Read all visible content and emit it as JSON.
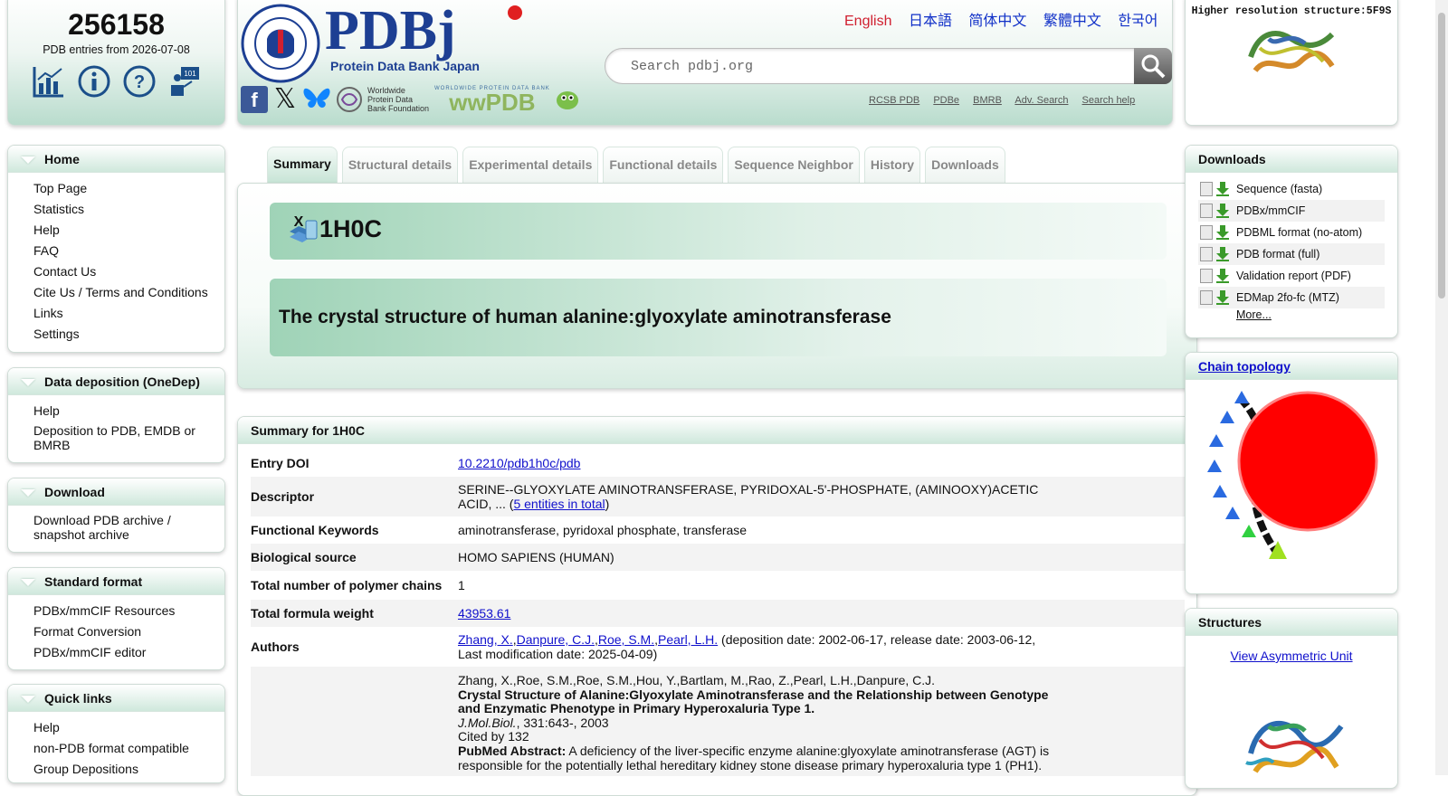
{
  "counter": {
    "number": "256158",
    "subtitle": "PDB entries from 2026-07-08"
  },
  "header": {
    "logo_text": "PDBj",
    "logo_sub": "Protein Data Bank Japan",
    "seal_text": "PROTEIN DATA BANK JAPAN · THE UNIVERSITY OF OSAKA",
    "wwpdb_foundation": "Worldwide Protein Data Bank Foundation",
    "wwpdb_text": "WORLDWIDE PROTEIN DATA BANK",
    "languages": [
      "English",
      "日本語",
      "简体中文",
      "繁體中文",
      "한국어"
    ],
    "search_placeholder": "Search pdbj.org",
    "ext_links": [
      "RCSB PDB",
      "PDBe",
      "BMRB",
      "Adv. Search",
      "Search help"
    ]
  },
  "hires": {
    "title": "Higher resolution structure:5F9S"
  },
  "nav": [
    {
      "title": "Home",
      "items": [
        "Top Page",
        "Statistics",
        "Help",
        "FAQ",
        "Contact Us",
        "Cite Us / Terms and Conditions",
        "Links",
        "Settings"
      ]
    },
    {
      "title": "Data deposition (OneDep)",
      "items": [
        "Help",
        "Deposition to PDB, EMDB or BMRB"
      ]
    },
    {
      "title": "Download",
      "items": [
        "Download PDB archive / snapshot archive"
      ]
    },
    {
      "title": "Standard format",
      "items": [
        "PDBx/mmCIF Resources",
        "Format Conversion",
        "PDBx/mmCIF editor"
      ]
    },
    {
      "title": "Quick links",
      "items": [
        "Help",
        "non-PDB format compatible",
        "Group Depositions"
      ]
    }
  ],
  "tabs": [
    "Summary",
    "Structural details",
    "Experimental details",
    "Functional details",
    "Sequence Neighbor",
    "History",
    "Downloads"
  ],
  "entry": {
    "id": "1H0C",
    "title": "The crystal structure of human alanine:glyoxylate aminotransferase"
  },
  "summary": {
    "header": "Summary for 1H0C",
    "doi_label": "Entry DOI",
    "doi": "10.2210/pdb1h0c/pdb",
    "descriptor_label": "Descriptor",
    "descriptor": "SERINE--GLYOXYLATE AMINOTRANSFERASE, PYRIDOXAL-5'-PHOSPHATE, (AMINOOXY)ACETIC ACID, ... (",
    "descriptor_link": "5 entities in total",
    "descriptor_end": ")",
    "keywords_label": "Functional Keywords",
    "keywords": "aminotransferase, pyridoxal phosphate, transferase",
    "source_label": "Biological source",
    "source": "HOMO SAPIENS (HUMAN)",
    "chains_label": "Total number of polymer chains",
    "chains": "1",
    "weight_label": "Total formula weight",
    "weight": "43953.61",
    "authors_label": "Authors",
    "authors": [
      "Zhang, X.",
      "Danpure, C.J.",
      "Roe, S.M.",
      "Pearl, L.H."
    ],
    "authors_dates": " (deposition date: 2002-06-17, release date: 2003-06-12, Last modification date: 2025-04-09)",
    "citation_authors": "Zhang, X.,Roe, S.M.,Roe, S.M.,Hou, Y.,Bartlam, M.,Rao, Z.,Pearl, L.H.,Danpure, C.J.",
    "citation_title": "Crystal Structure of Alanine:Glyoxylate Aminotransferase and the Relationship between Genotype and Enzymatic Phenotype in Primary Hyperoxaluria Type 1.",
    "citation_journal": "J.Mol.Biol.",
    "citation_ref": ", 331:643-, 2003",
    "cited_by": "Cited by 132",
    "abstract_label": "PubMed Abstract:",
    "abstract": " A deficiency of the liver-specific enzyme alanine:glyoxylate aminotransferase (AGT) is responsible for the potentially lethal hereditary kidney stone disease primary hyperoxaluria type 1 (PH1)."
  },
  "downloads": {
    "title": "Downloads",
    "items": [
      "Sequence (fasta)",
      "PDBx/mmCIF",
      "PDBML format (no-atom)",
      "PDB format (full)",
      "Validation report (PDF)",
      "EDMap 2fo-fc (MTZ)"
    ],
    "more": "More..."
  },
  "chain_topology": {
    "title": "Chain topology"
  },
  "structures": {
    "title": "Structures",
    "link": "View Asymmetric Unit"
  }
}
